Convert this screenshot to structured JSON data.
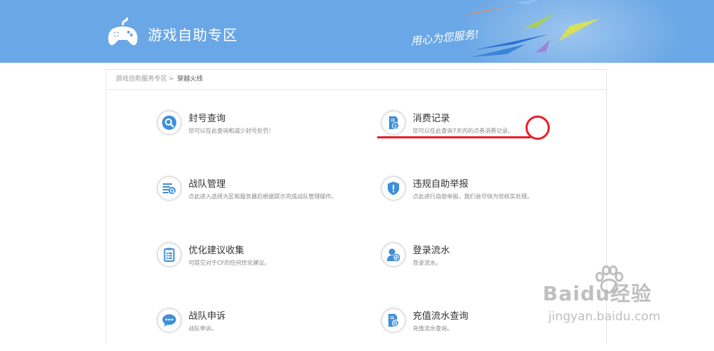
{
  "header": {
    "title": "游戏自助专区",
    "slogan": "用心为您服务!"
  },
  "breadcrumb": {
    "home": "游戏自助服务专区",
    "separator": ">",
    "current": "穿越火线"
  },
  "services": [
    {
      "icon": "search-icon",
      "title": "封号查询",
      "desc": "您可以在此查询和减少封号处罚！"
    },
    {
      "icon": "bill-icon",
      "title": "消费记录",
      "desc": "您可以在此查询7天内的点券消费记录。"
    },
    {
      "icon": "team-manage-icon",
      "title": "战队管理",
      "desc": "点此进入选择大区和服务器后根据提示完成战队管理操作。"
    },
    {
      "icon": "shield-icon",
      "title": "违规自助举报",
      "desc": "点此进行自助举报，我们会尽快为您核实处理。"
    },
    {
      "icon": "clipboard-icon",
      "title": "优化建议收集",
      "desc": "可提交对于CF的任何优化建议。"
    },
    {
      "icon": "login-log-icon",
      "title": "登录流水",
      "desc": "登录流水。"
    },
    {
      "icon": "chat-bubble-icon",
      "title": "战队申诉",
      "desc": "战队申诉。"
    },
    {
      "icon": "recharge-log-icon",
      "title": "充值流水查询",
      "desc": "充值流水查询。"
    }
  ],
  "watermark": {
    "brand": "Baidu经验",
    "url": "jingyan.baidu.com"
  },
  "colors": {
    "banner": "#6aa7e6",
    "icon_blue": "#3f8fd8",
    "annotation_red": "#e8202a"
  }
}
